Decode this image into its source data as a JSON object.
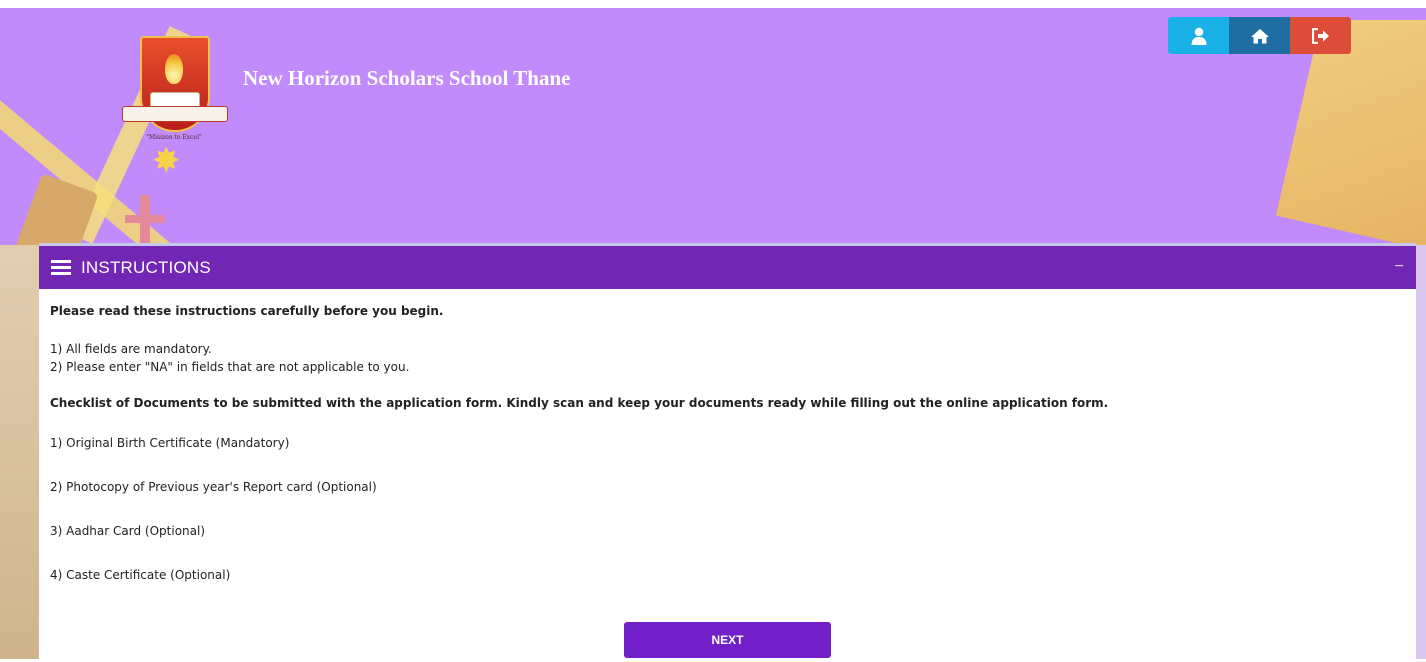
{
  "header": {
    "school_name": "New Horizon Scholars School Thane",
    "logo_motto": "\"Mission to Excel\"",
    "accent_color": "#c18bfb"
  },
  "top_nav": {
    "buttons": [
      {
        "icon": "user-icon",
        "color": "#1ab2e6"
      },
      {
        "icon": "home-icon",
        "color": "#1f6ea3"
      },
      {
        "icon": "sign-out-icon",
        "color": "#dd4b39"
      }
    ]
  },
  "panel": {
    "title": "INSTRUCTIONS",
    "collapse_label": "−",
    "header_color": "#7126b4",
    "intro": "Please read these instructions carefully before you begin.",
    "rules": [
      "1) All fields are mandatory.",
      "2) Please enter \"NA\" in fields that are not applicable to you."
    ],
    "checklist_title": "Checklist of Documents to be submitted with the application form. Kindly scan and keep your documents ready while filling out the online application form.",
    "documents": [
      "1) Original Birth Certificate (Mandatory)",
      "2) Photocopy of Previous year's Report card (Optional)",
      "3) Aadhar Card (Optional)",
      "4) Caste Certificate (Optional)"
    ],
    "next_label": "NEXT"
  }
}
